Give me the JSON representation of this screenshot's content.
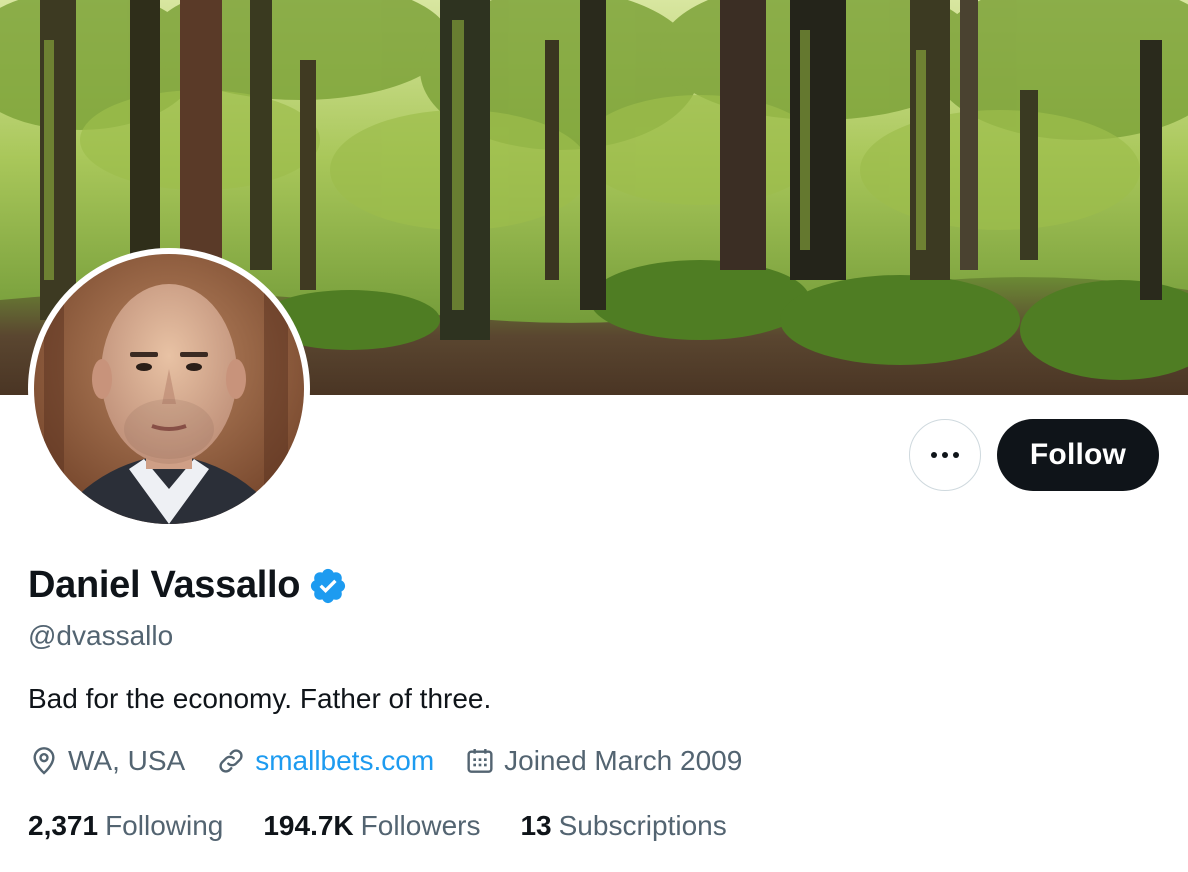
{
  "profile": {
    "display_name": "Daniel Vassallo",
    "handle": "@dvassallo",
    "bio": "Bad for the economy. Father of three.",
    "verified": true
  },
  "actions": {
    "more_icon": "more-horizontal-icon",
    "follow_label": "Follow"
  },
  "meta": {
    "location": "WA, USA",
    "website": "smallbets.com",
    "joined": "Joined March 2009",
    "location_icon": "location-pin-icon",
    "link_icon": "link-icon",
    "calendar_icon": "calendar-icon"
  },
  "stats": {
    "following_count": "2,371",
    "following_label": "Following",
    "followers_count": "194.7K",
    "followers_label": "Followers",
    "subscriptions_count": "13",
    "subscriptions_label": "Subscriptions"
  },
  "colors": {
    "primary_text": "#0f1419",
    "secondary_text": "#536471",
    "link": "#1d9bf0",
    "verified": "#1d9bf0",
    "follow_button_bg": "#0f1419"
  }
}
